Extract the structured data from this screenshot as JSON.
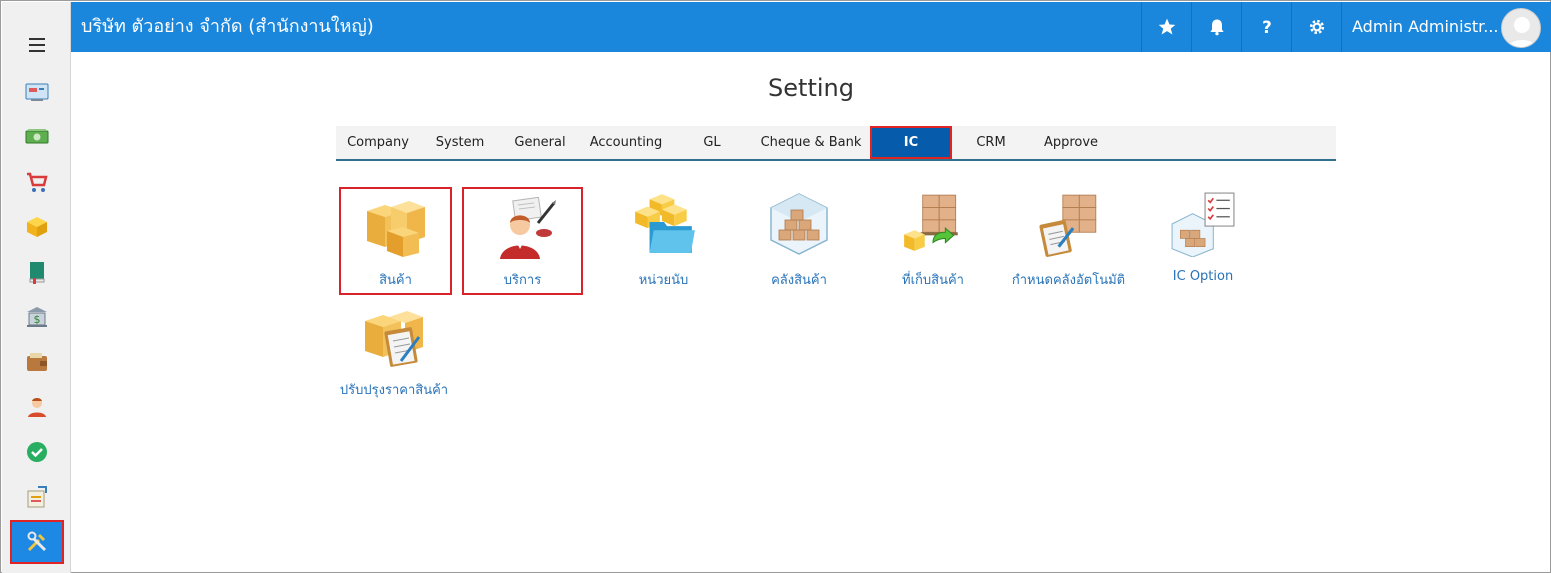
{
  "header": {
    "company": "บริษัท ตัวอย่าง จำกัด (สำนักงานใหญ่)",
    "user": "Admin Administr..."
  },
  "page": {
    "title": "Setting"
  },
  "tabs": [
    {
      "label": "Company"
    },
    {
      "label": "System"
    },
    {
      "label": "General"
    },
    {
      "label": "Accounting"
    },
    {
      "label": "GL"
    },
    {
      "label": "Cheque & Bank"
    },
    {
      "label": "IC"
    },
    {
      "label": "CRM"
    },
    {
      "label": "Approve"
    }
  ],
  "active_tab": "IC",
  "tiles": [
    {
      "label": "สินค้า"
    },
    {
      "label": "บริการ"
    },
    {
      "label": "หน่วยนับ"
    },
    {
      "label": "คลังสินค้า"
    },
    {
      "label": "ที่เก็บสินค้า"
    },
    {
      "label": "กำหนดคลังอัตโนมัติ"
    },
    {
      "label": "IC Option"
    },
    {
      "label": "ปรับปรุงราคาสินค้า"
    }
  ],
  "sidebar_icons": [
    "dashboard-icon",
    "money-icon",
    "cart-icon",
    "box-icon",
    "book-icon",
    "bank-icon",
    "wallet-icon",
    "user-icon",
    "check-icon",
    "report-icon",
    "tools-icon"
  ],
  "colors": {
    "header": "#1a87dc",
    "active_tab": "#075bab",
    "highlight": "#e02424",
    "link": "#2873b8"
  }
}
